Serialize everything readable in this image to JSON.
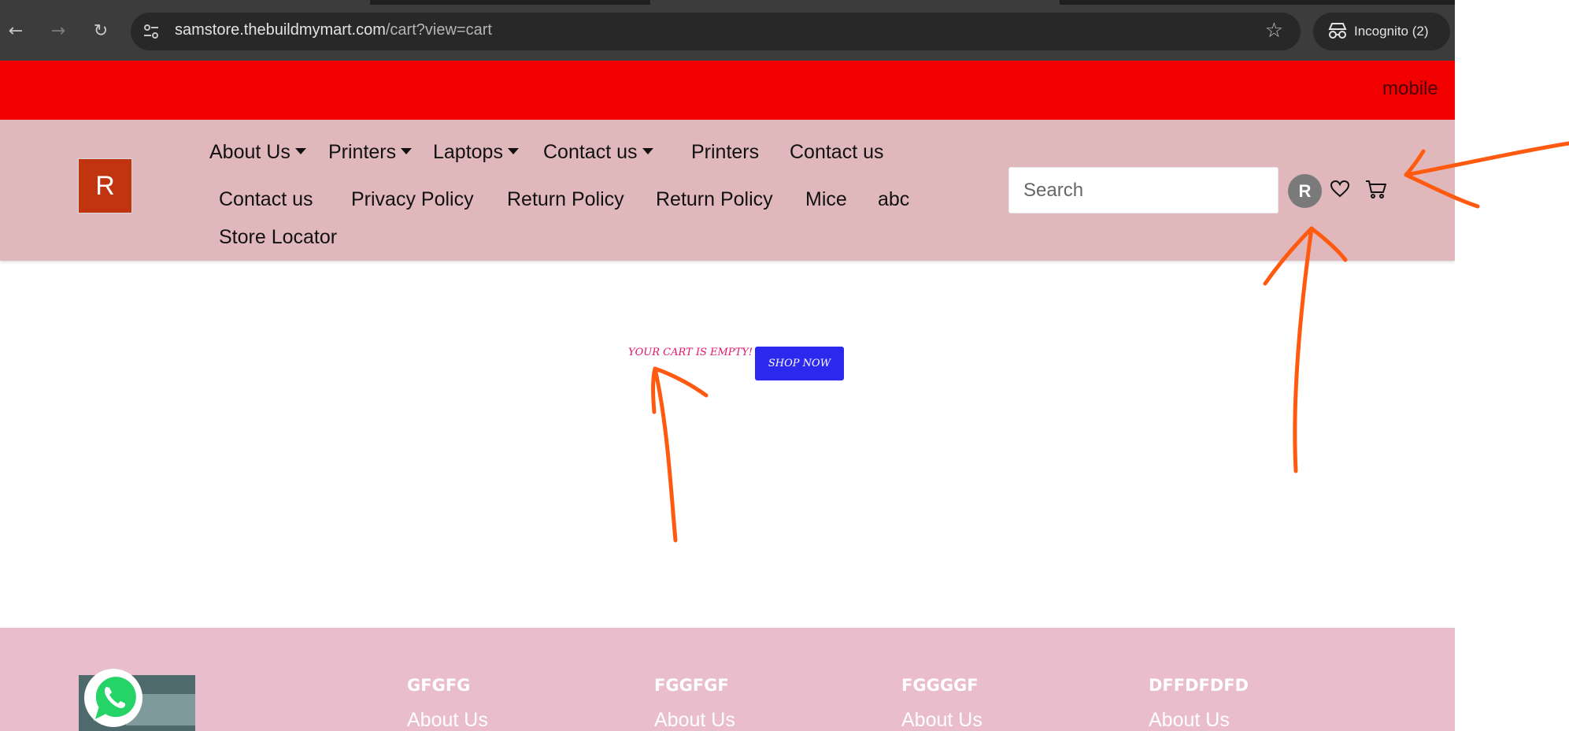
{
  "browser": {
    "url_host": "samstore.thebuildmymart.com",
    "url_path": "/cart?view=cart",
    "profile_label": "Incognito (2)"
  },
  "announcement": {
    "text": "mobile"
  },
  "header": {
    "logo_letter": "R",
    "nav_row1": [
      {
        "label": "About Us",
        "dropdown": true
      },
      {
        "label": "Printers",
        "dropdown": true
      },
      {
        "label": "Laptops",
        "dropdown": true
      },
      {
        "label": "Contact us",
        "dropdown": true
      },
      {
        "label": "Printers",
        "dropdown": false
      },
      {
        "label": "Contact us",
        "dropdown": false
      }
    ],
    "nav_row2": [
      {
        "label": "Contact us"
      },
      {
        "label": "Privacy Policy"
      },
      {
        "label": "Return Policy"
      },
      {
        "label": "Return Policy"
      },
      {
        "label": "Mice"
      },
      {
        "label": "abc"
      }
    ],
    "nav_row3": [
      {
        "label": "Store Locator"
      }
    ],
    "search_placeholder": "Search",
    "avatar_letter": "R"
  },
  "main": {
    "empty_message": "YOUR CART IS EMPTY!",
    "shop_now_label": "SHOP NOW"
  },
  "footer": {
    "columns": [
      {
        "heading": "GFGFG",
        "first_link": "About Us"
      },
      {
        "heading": "FGGFGF",
        "first_link": "About Us"
      },
      {
        "heading": "FGGGGF",
        "first_link": "About Us"
      },
      {
        "heading": "DFFDFDFD",
        "first_link": "About Us"
      }
    ]
  },
  "colors": {
    "announcement_bg": "#f20000",
    "header_bg": "#e0b8bb",
    "logo_bg": "#c0350f",
    "empty_text": "#e2156a",
    "shop_button": "#2d28ee",
    "footer_bg": "#e9bdcc",
    "annotation": "#ff5a0f"
  }
}
